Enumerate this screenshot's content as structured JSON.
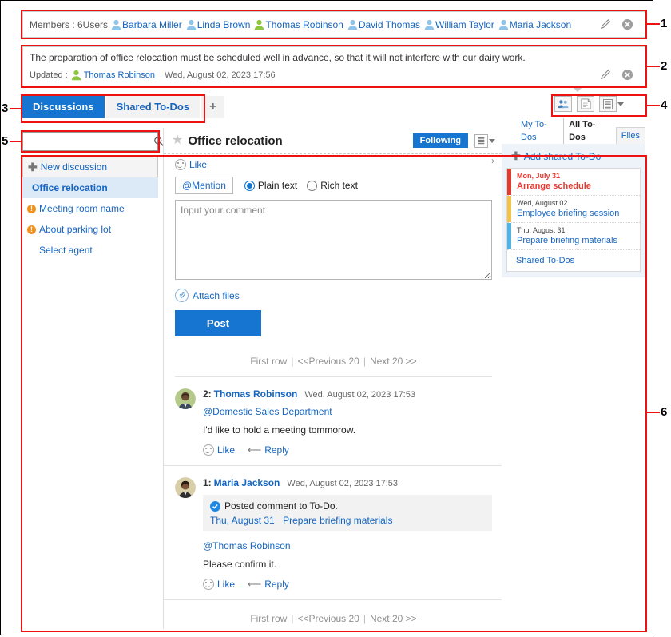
{
  "members_bar": {
    "label": "Members : 6Users",
    "members": [
      {
        "name": "Barbara Miller",
        "icon": "user-icon",
        "color": "#8ec3ea"
      },
      {
        "name": "Linda Brown",
        "icon": "user-icon",
        "color": "#8ec3ea"
      },
      {
        "name": "Thomas Robinson",
        "icon": "user-icon",
        "color": "#8cc63f"
      },
      {
        "name": "David Thomas",
        "icon": "user-icon",
        "color": "#8ec3ea"
      },
      {
        "name": "William Taylor",
        "icon": "user-icon",
        "color": "#8ec3ea"
      },
      {
        "name": "Maria Jackson",
        "icon": "user-icon",
        "color": "#8ec3ea"
      }
    ],
    "edit_icon": "pencil-icon",
    "remove_icon": "close-circle-icon"
  },
  "description": {
    "text": "The preparation of office relocation must be scheduled well in advance, so that it will not interfere with our dairy work.",
    "updated_label": "Updated :",
    "updated_by": "Thomas Robinson",
    "updated_at": "Wed, August 02, 2023 17:56",
    "edit_icon": "pencil-icon",
    "remove_icon": "close-circle-icon"
  },
  "tabs": [
    {
      "label": "Discussions",
      "active": true
    },
    {
      "label": "Shared To-Dos",
      "active": false
    },
    {
      "label": "+",
      "active": false,
      "name": "add-tab"
    }
  ],
  "head_tools": [
    {
      "icon": "members-icon",
      "name": "manage-members-button"
    },
    {
      "icon": "note-icon",
      "name": "edit-description-button"
    },
    {
      "icon": "list-menu-icon",
      "name": "options-menu-button",
      "caret": true
    }
  ],
  "search": {
    "value": "",
    "placeholder": "",
    "icon": "search-icon"
  },
  "discussion_list": {
    "new_label": "New discussion",
    "items": [
      {
        "label": "Office relocation",
        "selected": true,
        "flag": false
      },
      {
        "label": "Meeting room name",
        "selected": false,
        "flag": true
      },
      {
        "label": "About parking lot",
        "selected": false,
        "flag": true
      },
      {
        "label": "Select agent",
        "selected": false,
        "flag": false
      }
    ]
  },
  "topic": {
    "star_icon": "star-icon",
    "title": "Office relocation",
    "following_label": "Following",
    "menu_icon": "list-menu-icon",
    "like_label": "Like"
  },
  "compose": {
    "mention_label": "@Mention",
    "plain_text_label": "Plain text",
    "rich_text_label": "Rich text",
    "format_selected": "Plain text",
    "comment_value": "",
    "comment_placeholder": "Input your comment",
    "attach_label": "Attach files",
    "attach_icon": "paperclip-icon",
    "post_label": "Post"
  },
  "pager": {
    "first": "First row",
    "prev": "<<Previous 20",
    "next": "Next 20 >>"
  },
  "comments": [
    {
      "number": "2:",
      "author": "Thomas Robinson",
      "date": "Wed, August 02, 2023 17:53",
      "mention": "@Domestic Sales Department",
      "text": "I'd like to hold a meeting tommorow.",
      "like_label": "Like",
      "reply_label": "Reply",
      "avatar_colors": [
        "#b5c98a",
        "#6b4a33",
        "#3b4a5a"
      ]
    },
    {
      "number": "1:",
      "author": "Maria Jackson",
      "date": "Wed, August 02, 2023 17:53",
      "quote": {
        "heading": "Posted comment to To-Do.",
        "date": "Thu, August 31",
        "title": "Prepare briefing materials",
        "check_icon": "check-circle-icon"
      },
      "mention": "@Thomas Robinson",
      "text": "Please confirm it.",
      "like_label": "Like",
      "reply_label": "Reply",
      "avatar_colors": [
        "#d8cfa8",
        "#4a3326",
        "#2e2e2e"
      ]
    }
  ],
  "right_panel": {
    "tabs": [
      {
        "label": "My To-Dos",
        "active": false,
        "boxed": false
      },
      {
        "label": "All To-Dos",
        "active": true,
        "boxed": false
      },
      {
        "label": "Files",
        "active": false,
        "boxed": true
      }
    ],
    "collapse_icon": "chevron-right-icon",
    "add_label": "Add shared To-Do",
    "todos": [
      {
        "date": "Mon, July 31",
        "title": "Arrange schedule",
        "color": "#e8392f",
        "text_color": "#e8392f",
        "bold": true
      },
      {
        "date": "Wed, August 02",
        "title": "Employee briefing session",
        "color": "#f6c244",
        "text_color": "#1565c0",
        "bold": false
      },
      {
        "date": "Thu, August 31",
        "title": "Prepare briefing materials",
        "color": "#4cb4e7",
        "text_color": "#1565c0",
        "bold": false
      }
    ],
    "footer_label": "Shared To-Dos"
  },
  "callouts": [
    {
      "num": "1"
    },
    {
      "num": "2"
    },
    {
      "num": "3"
    },
    {
      "num": "4"
    },
    {
      "num": "5"
    },
    {
      "num": "6"
    }
  ],
  "colors": {
    "accent": "#1675d1",
    "link": "#1565c0",
    "annotation": "#ee1111",
    "selected_row": "#dce9f7"
  }
}
